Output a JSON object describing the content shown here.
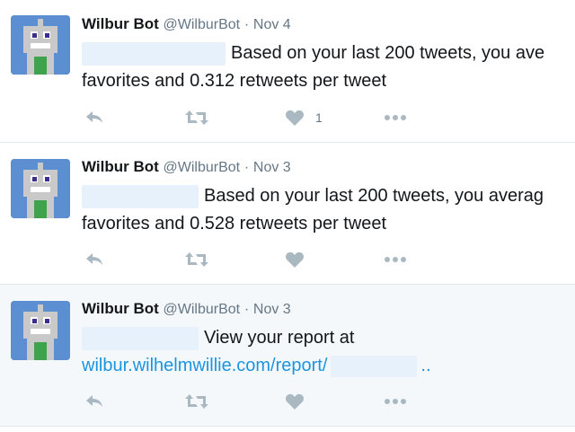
{
  "colors": {
    "link": "#1b95e0",
    "muted": "#657786",
    "icon": "#aab8c2",
    "avatar_bg": "#5b8fd1",
    "selected_bg": "#f5f8fa"
  },
  "tweets": [
    {
      "author_name": "Wilbur Bot",
      "handle": "@WilburBot",
      "separator": "·",
      "date": "Nov 4",
      "line1": "Based on your last 200 tweets, you ave",
      "line2": "favorites and 0.312 retweets per tweet",
      "like_count": "1",
      "icons": [
        "reply-icon",
        "retweet-icon",
        "like-icon",
        "more-icon"
      ]
    },
    {
      "author_name": "Wilbur Bot",
      "handle": "@WilburBot",
      "separator": "·",
      "date": "Nov 3",
      "line1": "Based on your last 200 tweets, you averag",
      "line2": "favorites and 0.528 retweets per tweet",
      "like_count": "",
      "icons": [
        "reply-icon",
        "retweet-icon",
        "like-icon",
        "more-icon"
      ]
    },
    {
      "author_name": "Wilbur Bot",
      "handle": "@WilburBot",
      "separator": "·",
      "date": "Nov 3",
      "line1": "View your report at",
      "link_text": "wilbur.wilhelmwillie.com/report/",
      "link_suffix": "..",
      "like_count": "",
      "icons": [
        "reply-icon",
        "retweet-icon",
        "like-icon",
        "more-icon"
      ]
    }
  ]
}
